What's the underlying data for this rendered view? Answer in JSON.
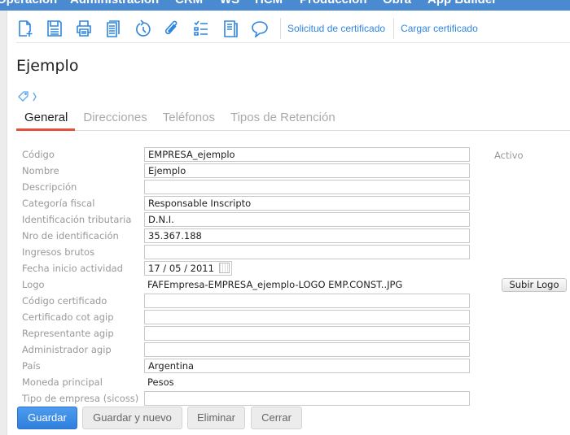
{
  "top_menu": [
    "Operación",
    "Administración",
    "CRM",
    "WS",
    "HCM",
    "Producción",
    "Obra",
    "App Builder"
  ],
  "toolbar": {
    "icons": [
      "new-document-icon",
      "save-icon",
      "print-icon",
      "copy-icon",
      "history-icon",
      "attachment-icon",
      "checklist-icon",
      "report-icon",
      "comment-icon"
    ],
    "links": [
      "Solicitud de certificado",
      "Cargar certificado"
    ]
  },
  "page_title": "Ejemplo",
  "tabs": [
    "General",
    "Direcciones",
    "Teléfonos",
    "Tipos de Retención"
  ],
  "fields": [
    {
      "label": "Código",
      "value": "EMPRESA_ejemplo",
      "type": "input"
    },
    {
      "label": "Nombre",
      "value": "Ejemplo",
      "type": "input"
    },
    {
      "label": "Descripción",
      "value": "",
      "type": "input"
    },
    {
      "label": "Categoría fiscal",
      "value": "Responsable Inscripto",
      "type": "input"
    },
    {
      "label": "Identificación tributaria",
      "value": "D.N.I.",
      "type": "input"
    },
    {
      "label": "Nro de identificación",
      "value": "35.367.188",
      "type": "input"
    },
    {
      "label": "Ingresos brutos",
      "value": "",
      "type": "input"
    },
    {
      "label": "Fecha inicio actividad",
      "value": "17 / 05 / 2011",
      "type": "date"
    },
    {
      "label": "Logo",
      "value": "FAFEmpresa-EMPRESA_ejemplo-LOGO EMP.CONST..JPG",
      "type": "text"
    },
    {
      "label": "Código certificado",
      "value": "",
      "type": "input"
    },
    {
      "label": "Certificado cot agip",
      "value": "",
      "type": "input"
    },
    {
      "label": "Representante agip",
      "value": "",
      "type": "input"
    },
    {
      "label": "Administrador agip",
      "value": "",
      "type": "input"
    },
    {
      "label": "País",
      "value": "Argentina",
      "type": "input"
    },
    {
      "label": "Moneda principal",
      "value": "Pesos",
      "type": "text"
    },
    {
      "label": "Tipo de empresa (sicoss)",
      "value": "",
      "type": "input"
    }
  ],
  "activo_label": "Activo",
  "subir_logo": "Subir Logo",
  "buttons": {
    "guardar": "Guardar",
    "guardar_nuevo": "Guardar y nuevo",
    "eliminar": "Eliminar",
    "cerrar": "Cerrar"
  },
  "colors": {
    "menu_bar": "#4a8ad0",
    "accent": "#2f86e0",
    "tab_underline": "#e8503a"
  }
}
